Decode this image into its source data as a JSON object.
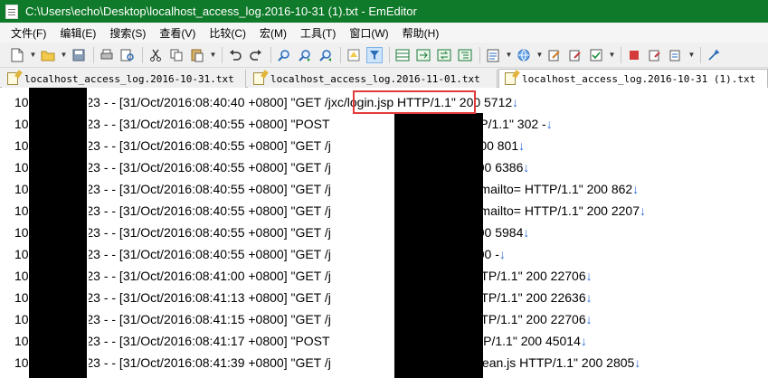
{
  "window": {
    "title": "C:\\Users\\echo\\Desktop\\localhost_access_log.2016-10-31 (1).txt - EmEditor"
  },
  "menu": [
    "文件(F)",
    "编辑(E)",
    "搜索(S)",
    "查看(V)",
    "比较(C)",
    "宏(M)",
    "工具(T)",
    "窗口(W)",
    "帮助(H)"
  ],
  "tabs": [
    {
      "label": "localhost_access_log.2016-10-31.txt"
    },
    {
      "label": "localhost_access_log.2016-11-01.txt"
    },
    {
      "label": "localhost_access_log.2016-10-31 (1).txt"
    }
  ],
  "editor": {
    "eol_glyph": "↓",
    "lines": [
      {
        "prefix": "10",
        "middle": "223 - - [31/Oct/2016:08:40:40 +0800] \"",
        "method": "GET /jxc/login.jsp",
        "suffix": " HTTP/1.1\" 200 5712"
      },
      {
        "prefix": "10",
        "middle": "223 - - [31/Oct/2016:08:40:55 +0800] \"",
        "method": "POST",
        "suffix": "cess.jsp HTTP/1.1\" 302 -"
      },
      {
        "prefix": "10",
        "middle": "223 - - [31/Oct/2016:08:40:55 +0800] \"",
        "method": "GET /j",
        "suffix": "TTP/1.1\" 200 801"
      },
      {
        "prefix": "10",
        "middle": "223 - - [31/Oct/2016:08:40:55 +0800] \"",
        "method": "GET /j",
        "suffix": "TP/1.1\" 200 6386"
      },
      {
        "prefix": "10",
        "middle": "223 - - [31/Oct/2016:08:40:55 +0800] \"",
        "method": "GET /j",
        "suffix": "?email=0&mailto= HTTP/1.1\" 200 862"
      },
      {
        "prefix": "10",
        "middle": "223 - - [31/Oct/2016:08:40:55 +0800] \"",
        "method": "GET /j",
        "suffix": "?email=0&mailto= HTTP/1.1\" 200 2207"
      },
      {
        "prefix": "10",
        "middle": "223 - - [31/Oct/2016:08:40:55 +0800] \"",
        "method": "GET /j",
        "suffix": "TP/1.1\" 200 5984"
      },
      {
        "prefix": "10",
        "middle": "223 - - [31/Oct/2016:08:40:55 +0800] \"",
        "method": "GET /j",
        "suffix": "TP/1.1\" 200 -"
      },
      {
        "prefix": "10",
        "middle": "223 - - [31/Oct/2016:08:41:00 +0800] \"",
        "method": "GET /j",
        "suffix": "list.jsp HTTP/1.1\" 200 22706"
      },
      {
        "prefix": "10",
        "middle": "223 - - [31/Oct/2016:08:41:13 +0800] \"",
        "method": "GET /j",
        "suffix": "list.jsp HTTP/1.1\" 200 22636"
      },
      {
        "prefix": "10",
        "middle": "223 - - [31/Oct/2016:08:41:15 +0800] \"",
        "method": "GET /j",
        "suffix": "list.jsp HTTP/1.1\" 200 22706"
      },
      {
        "prefix": "10",
        "middle": "223 - - [31/Oct/2016:08:41:17 +0800] \"",
        "method": "POST",
        "suffix": "e_list.jsp HTTP/1.1\" 200 45014"
      },
      {
        "prefix": "10",
        "middle": "223 - - [31/Oct/2016:08:41:39 +0800] \"",
        "method": "GET /j",
        "suffix": "ace/AjaxBean.js HTTP/1.1\" 200 2805"
      }
    ]
  },
  "colors": {
    "titlebar": "#0f7a2a",
    "highlight": "#e33b3b",
    "eol": "#2f6fd6"
  }
}
